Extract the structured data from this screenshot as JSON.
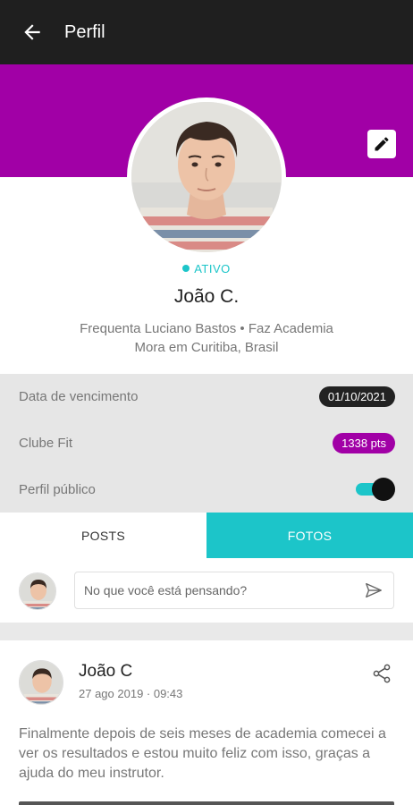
{
  "app_bar": {
    "title": "Perfil",
    "back_icon": "arrow-left-icon"
  },
  "colors": {
    "app_bar": "#1f1f1f",
    "banner": "#a100a6",
    "accent_teal": "#1cc5c9",
    "date_pill": "#222222",
    "points_pill": "#a100a6",
    "info_bg": "#e6e6e6"
  },
  "profile": {
    "status": "ATIVO",
    "name": "João C.",
    "meta_line1": "Frequenta Luciano Bastos • Faz Academia",
    "meta_line2": "Mora em Curitiba, Brasil",
    "edit_icon": "pencil-icon"
  },
  "info": {
    "expiry_label": "Data de vencimento",
    "expiry_value": "01/10/2021",
    "club_label": "Clube Fit",
    "club_value": "1338 pts",
    "public_label": "Perfil público",
    "public_enabled": true
  },
  "tabs": [
    {
      "label": "POSTS",
      "active": false
    },
    {
      "label": "FOTOS",
      "active": true
    }
  ],
  "composer": {
    "placeholder": "No que você está pensando?",
    "send_icon": "send-icon"
  },
  "post": {
    "author": "João C",
    "date": "27 ago 2019 · 09:43",
    "text": "Finalmente depois de seis meses de academia comecei a ver os resultados e estou muito feliz com isso, graças a ajuda do meu instrutor.",
    "share_icon": "share-icon"
  }
}
